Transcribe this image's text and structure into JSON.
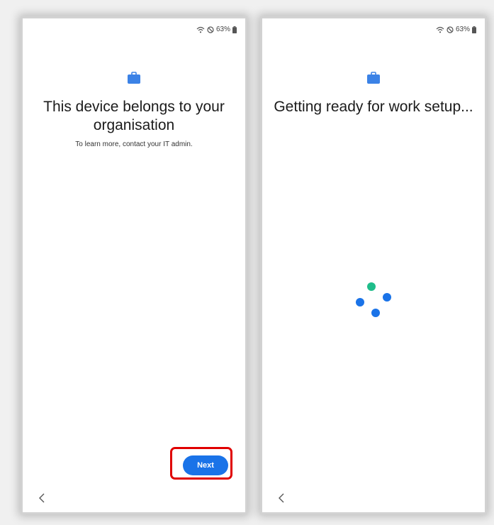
{
  "status": {
    "battery": "63%",
    "icons": [
      "wifi-icon",
      "do-not-disturb-icon",
      "battery-icon"
    ]
  },
  "screen_left": {
    "title": "This device belongs to your organisation",
    "subtitle": "To learn more, contact your IT admin.",
    "next_label": "Next",
    "icon": "briefcase-icon",
    "back_icon": "chevron-left-icon"
  },
  "screen_right": {
    "title": "Getting ready for work setup...",
    "icon": "briefcase-icon",
    "back_icon": "chevron-left-icon",
    "spinner_colors": [
      "#1fbd8a",
      "#1a73e8",
      "#1a73e8",
      "#1a73e8"
    ]
  },
  "colors": {
    "accent": "#1a73e8",
    "highlight": "#e00000",
    "briefcase": "#3b82e6"
  }
}
